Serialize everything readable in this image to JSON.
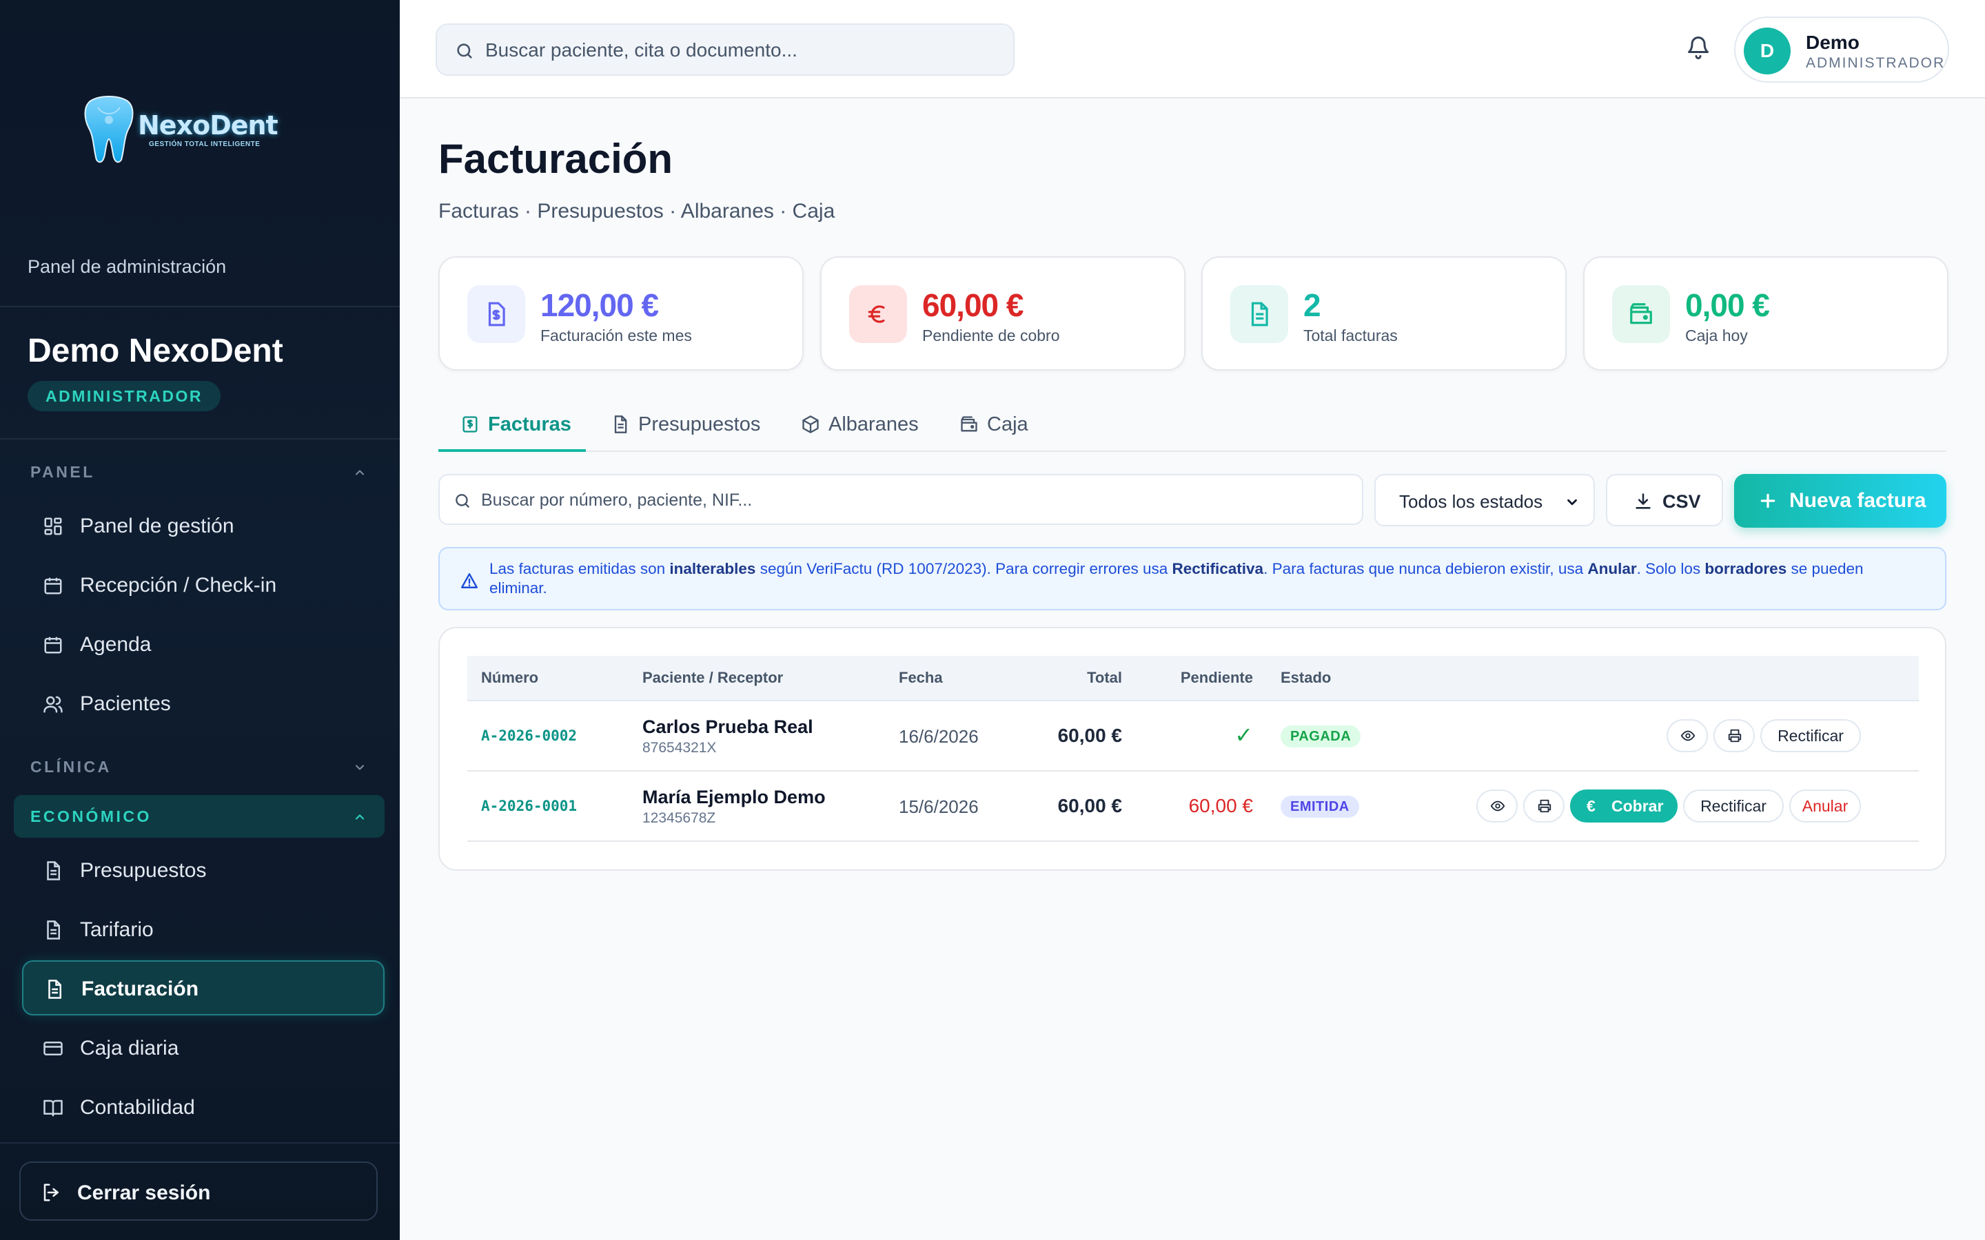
{
  "brand": {
    "name": "NexoDent",
    "tagline": "GESTIÓN TOTAL INTELIGENTE"
  },
  "sidebar": {
    "caption": "Panel de administración",
    "clinic_name": "Demo NexoDent",
    "role": "ADMINISTRADOR",
    "sections": [
      {
        "title": "PANEL",
        "expanded": true,
        "items": [
          {
            "label": "Panel de gestión",
            "icon": "grid-icon"
          },
          {
            "label": "Recepción / Check-in",
            "icon": "calendar-icon"
          },
          {
            "label": "Agenda",
            "icon": "calendar-icon"
          },
          {
            "label": "Pacientes",
            "icon": "users-icon"
          }
        ]
      },
      {
        "title": "CLÍNICA",
        "expanded": false,
        "items": []
      },
      {
        "title": "ECONÓMICO",
        "expanded": true,
        "active": true,
        "items": [
          {
            "label": "Presupuestos",
            "icon": "document-icon"
          },
          {
            "label": "Tarifario",
            "icon": "document-icon"
          },
          {
            "label": "Facturación",
            "icon": "document-icon",
            "active": true
          },
          {
            "label": "Caja diaria",
            "icon": "credit-card-icon"
          },
          {
            "label": "Contabilidad",
            "icon": "book-icon"
          }
        ]
      }
    ],
    "logout_label": "Cerrar sesión"
  },
  "topbar": {
    "search_placeholder": "Buscar paciente, cita o documento...",
    "user": {
      "initial": "D",
      "name": "Demo",
      "role": "ADMINISTRADOR"
    }
  },
  "page": {
    "title": "Facturación",
    "subtitle": "Facturas · Presupuestos · Albaranes · Caja"
  },
  "stats": [
    {
      "value": "120,00 €",
      "label": "Facturación este mes",
      "color": "#6366f1",
      "bg": "#eef2ff",
      "icon": "invoice-dollar-icon"
    },
    {
      "value": "60,00 €",
      "label": "Pendiente de cobro",
      "color": "#dc2626",
      "bg": "#fee2e2",
      "icon": "euro-icon"
    },
    {
      "value": "2",
      "label": "Total facturas",
      "color": "#14b8a6",
      "bg": "#e6f7f4",
      "icon": "document-icon"
    },
    {
      "value": "0,00 €",
      "label": "Caja hoy",
      "color": "#10b981",
      "bg": "#e6f7f0",
      "icon": "wallet-icon"
    }
  ],
  "tabs": [
    {
      "label": "Facturas",
      "icon": "invoice-icon",
      "active": true
    },
    {
      "label": "Presupuestos",
      "icon": "document-icon"
    },
    {
      "label": "Albaranes",
      "icon": "box-icon"
    },
    {
      "label": "Caja",
      "icon": "wallet-icon"
    }
  ],
  "toolbar": {
    "search_placeholder": "Buscar por número, paciente, NIF...",
    "state_filter": "Todos los estados",
    "csv_label": "CSV",
    "new_label": "Nueva factura"
  },
  "notice": {
    "parts": [
      "Las facturas emitidas son ",
      "inalterables",
      " según VeriFactu (RD 1007/2023). Para corregir errores usa ",
      "Rectificativa",
      ". Para facturas que nunca debieron existir, usa ",
      "Anular",
      ". Solo los ",
      "borradores",
      " se pueden eliminar."
    ]
  },
  "table": {
    "headers": [
      "Número",
      "Paciente / Receptor",
      "Fecha",
      "Total",
      "Pendiente",
      "Estado"
    ],
    "rows": [
      {
        "number": "A-2026-0002",
        "patient": "Carlos Prueba Real",
        "nif": "87654321X",
        "date": "16/6/2026",
        "total": "60,00 €",
        "pending": "✓",
        "status": "PAGADA",
        "actions": [
          "Rectificar"
        ]
      },
      {
        "number": "A-2026-0001",
        "patient": "María Ejemplo Demo",
        "nif": "12345678Z",
        "date": "15/6/2026",
        "total": "60,00 €",
        "pending": "60,00 €",
        "status": "EMITIDA",
        "actions": [
          "Cobrar",
          "Rectificar",
          "Anular"
        ]
      }
    ]
  }
}
